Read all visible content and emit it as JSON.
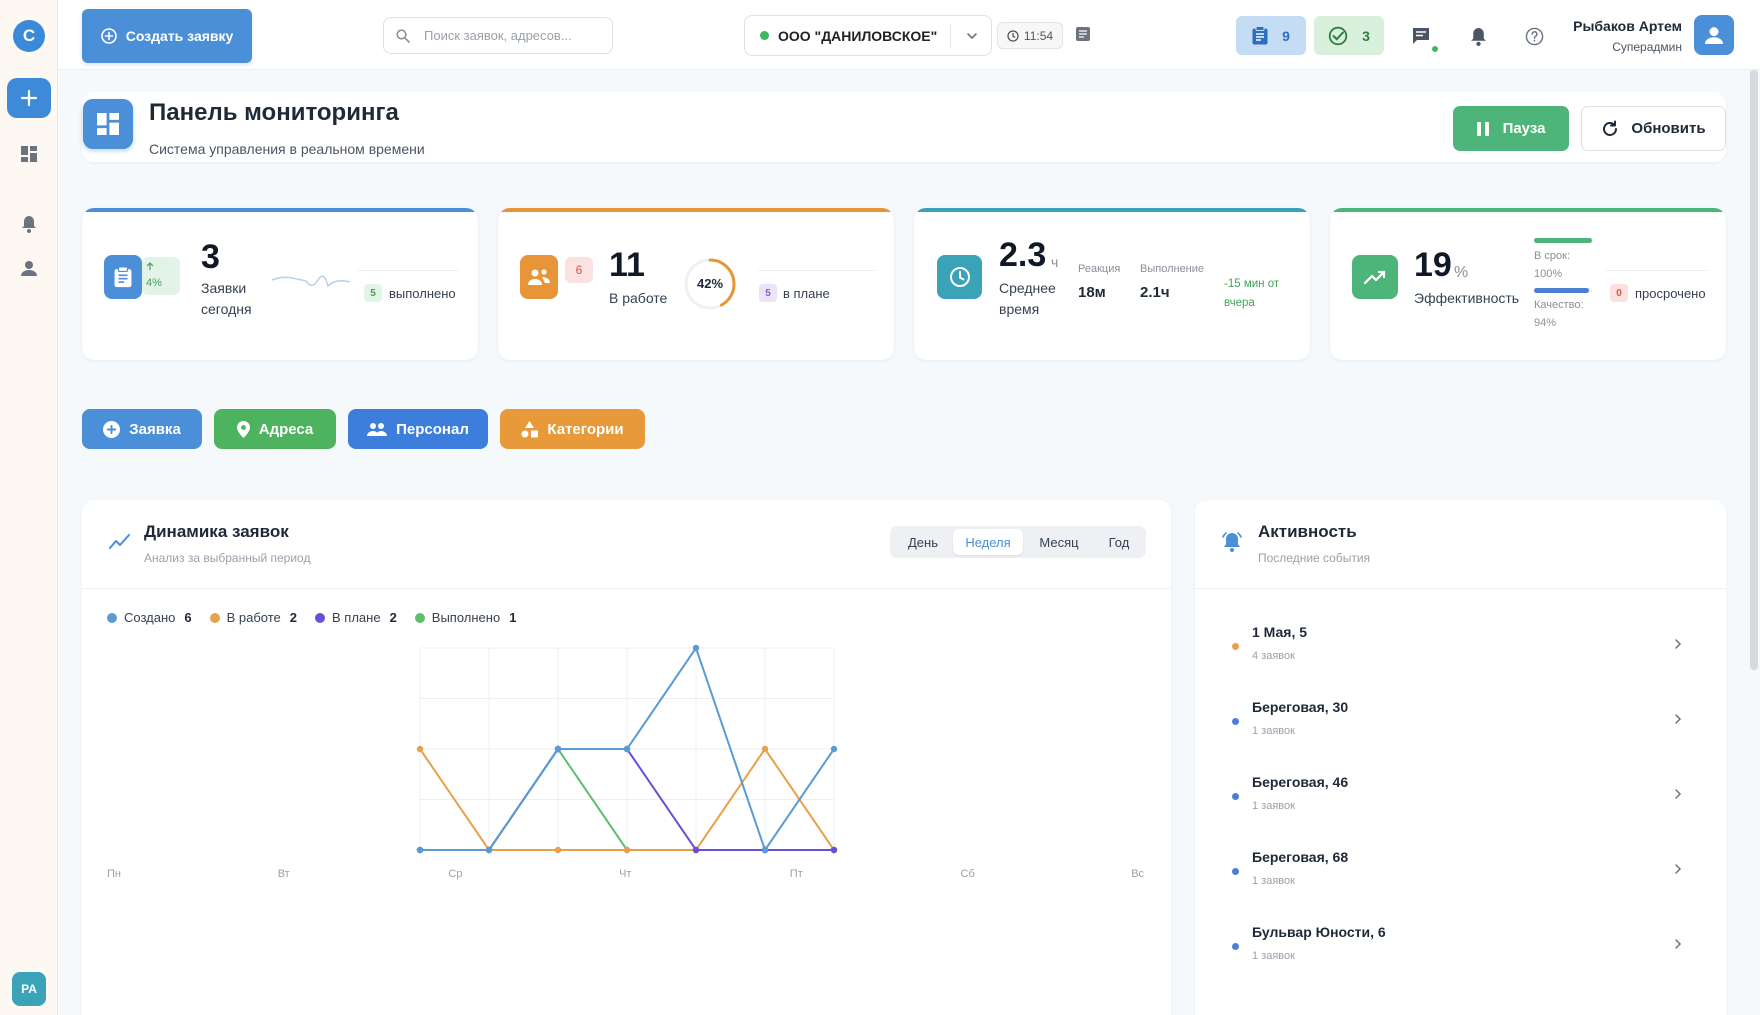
{
  "app": {
    "logo_letter": "C",
    "avatar_initials": "PA"
  },
  "topbar": {
    "create_label": "Создать заявку",
    "search_placeholder": "Поиск заявок, адресов...",
    "organization": "ООО \"ДАНИЛОВСКОЕ\"",
    "time": "11:54",
    "tasks_count": "9",
    "done_count": "3",
    "user_name": "Рыбаков Артем",
    "user_role": "Суперадмин"
  },
  "header": {
    "title": "Панель мониторинга",
    "subtitle": "Система управления в реальном времени",
    "pause_label": "Пауза",
    "refresh_label": "Обновить"
  },
  "stats": {
    "today": {
      "value": "3",
      "label": "Заявки сегодня",
      "trend": "4%",
      "done_count": "5",
      "done_label": "выполнено",
      "accent": "#4a8fd8"
    },
    "in_work": {
      "value": "11",
      "label": "В работе",
      "alert_count": "6",
      "progress": "42%",
      "progress_value": 42,
      "plan_count": "5",
      "plan_label": "в плане",
      "accent": "#e8953a"
    },
    "avg_time": {
      "value": "2.3",
      "unit": "ч",
      "label": "Среднее время",
      "reaction_label": "Реакция",
      "reaction_value": "18м",
      "exec_label": "Выполнение",
      "exec_value": "2.1ч",
      "delta": "-15 мин от вчера",
      "accent": "#3aa3b8"
    },
    "efficiency": {
      "value": "19",
      "unit": "%",
      "label": "Эффективность",
      "ontime_label": "В срок: 100%",
      "ontime_value": 100,
      "quality_label": "Качество: 94%",
      "quality_value": 94,
      "overdue_count": "0",
      "overdue_label": "просрочено",
      "accent": "#4db579"
    }
  },
  "quick_actions": [
    {
      "label": "Заявка",
      "color": "#4a8fd8"
    },
    {
      "label": "Адреса",
      "color": "#4db35f"
    },
    {
      "label": "Персонал",
      "color": "#3d7ddc"
    },
    {
      "label": "Категории",
      "color": "#e89a3a"
    }
  ],
  "chart_panel": {
    "title": "Динамика заявок",
    "subtitle": "Анализ за выбранный период",
    "periods": [
      "День",
      "Неделя",
      "Месяц",
      "Год"
    ],
    "active_period": "Неделя"
  },
  "chart_data": {
    "type": "line",
    "x": [
      "1",
      "2",
      "3",
      "4",
      "5",
      "6",
      "7"
    ],
    "x_tick_labels": [
      "Пн",
      "Вт",
      "Ср",
      "Чт",
      "Пт",
      "Сб",
      "Вс"
    ],
    "ylim": [
      0,
      2
    ],
    "grid": true,
    "legend_position": "top-left",
    "series": [
      {
        "name": "Создано",
        "total": "6",
        "color": "#5b9bd5",
        "values": [
          0,
          0,
          1,
          1,
          2,
          0,
          1
        ]
      },
      {
        "name": "В работе",
        "total": "2",
        "color": "#e8a04c",
        "values": [
          1,
          0,
          0,
          0,
          0,
          1,
          0
        ]
      },
      {
        "name": "В плане",
        "total": "2",
        "color": "#6a4fd6",
        "values": [
          0,
          0,
          1,
          1,
          0,
          0,
          0
        ]
      },
      {
        "name": "Выполнено",
        "total": "1",
        "color": "#5cbf6a",
        "values": [
          0,
          0,
          1,
          0,
          0,
          0,
          0
        ]
      }
    ]
  },
  "activity": {
    "title": "Активность",
    "subtitle": "Последние события",
    "items": [
      {
        "name": "1 Мая, 5",
        "count": "4 заявок",
        "color": "#e8a04c"
      },
      {
        "name": "Береговая, 30",
        "count": "1 заявок",
        "color": "#4a7fd6"
      },
      {
        "name": "Береговая, 46",
        "count": "1 заявок",
        "color": "#4a7fd6"
      },
      {
        "name": "Береговая, 68",
        "count": "1 заявок",
        "color": "#4a7fd6"
      },
      {
        "name": "Бульвар Юности, 6",
        "count": "1 заявок",
        "color": "#4a7fd6"
      }
    ]
  }
}
